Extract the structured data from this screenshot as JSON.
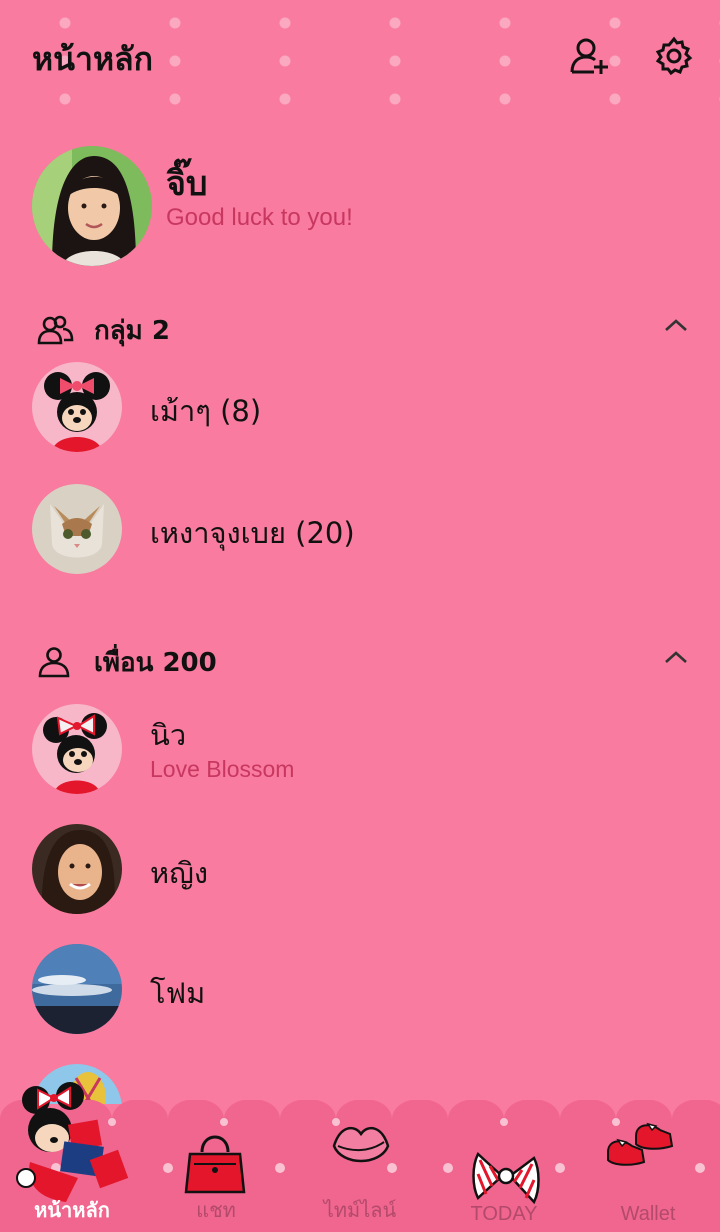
{
  "header": {
    "title": "หน้าหลัก",
    "add_friend_icon": "add-friend-icon",
    "settings_icon": "gear-icon"
  },
  "profile": {
    "name": "จิ๊บ",
    "status": "Good luck to you!"
  },
  "groups": {
    "label": "กลุ่ม 2",
    "items": [
      {
        "name": "เม้าๆ (8)",
        "avatar": "minnie-avatar"
      },
      {
        "name": "เหงาจุงเบย (20)",
        "avatar": "cat-avatar"
      }
    ]
  },
  "friends": {
    "label": "เพื่อน 200",
    "items": [
      {
        "name": "นิว",
        "status": "Love Blossom",
        "avatar": "minnie-avatar"
      },
      {
        "name": "หญิง",
        "status": "",
        "avatar": "woman-avatar"
      },
      {
        "name": "โฟม",
        "status": "",
        "avatar": "sky-avatar"
      }
    ]
  },
  "nav": {
    "tabs": [
      {
        "label": "หน้าหลัก",
        "icon": "minnie-icon",
        "active": true
      },
      {
        "label": "แชท",
        "icon": "handbag-icon",
        "active": false
      },
      {
        "label": "ไทม์ไลน์",
        "icon": "lips-icon",
        "active": false
      },
      {
        "label": "TODAY",
        "icon": "bow-icon",
        "active": false
      },
      {
        "label": "Wallet",
        "icon": "shoes-icon",
        "active": false
      }
    ]
  },
  "colors": {
    "background": "#f97b9f",
    "accent_text": "#c8375f",
    "nav_background": "#f0668f"
  }
}
